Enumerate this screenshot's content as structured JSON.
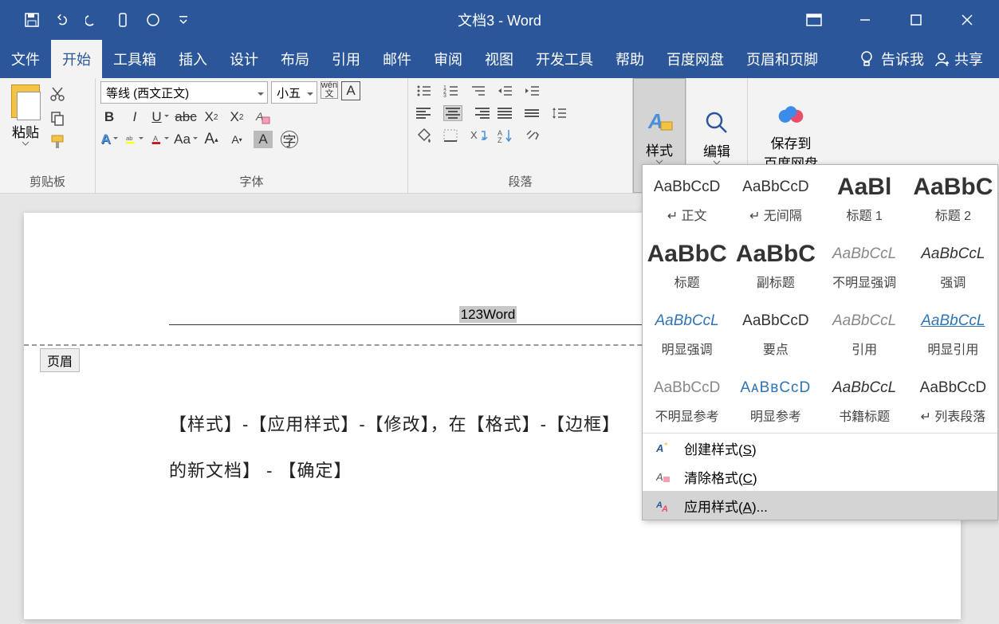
{
  "window": {
    "title": "文档3  -  Word"
  },
  "tabs": {
    "items": [
      "文件",
      "开始",
      "工具箱",
      "插入",
      "设计",
      "布局",
      "引用",
      "邮件",
      "审阅",
      "视图",
      "开发工具",
      "帮助",
      "百度网盘",
      "页眉和页脚"
    ],
    "active": 1,
    "tell_me": "告诉我",
    "share": "共享"
  },
  "ribbon": {
    "clipboard": {
      "paste": "粘贴",
      "label": "剪贴板"
    },
    "font": {
      "name": "等线 (西文正文)",
      "size": "小五",
      "label": "字体"
    },
    "paragraph": {
      "label": "段落"
    },
    "styles_btn": "样式",
    "edit_btn": "编辑",
    "baidu": {
      "line1": "保存到",
      "line2": "百度网盘"
    }
  },
  "styles_gallery": {
    "items": [
      {
        "preview": "AaBbCcD",
        "name": "↵ 正文",
        "cls": ""
      },
      {
        "preview": "AaBbCcD",
        "name": "↵ 无间隔",
        "cls": ""
      },
      {
        "preview": "AaBl",
        "name": "标题 1",
        "cls": "big"
      },
      {
        "preview": "AaBbC",
        "name": "标题 2",
        "cls": "big"
      },
      {
        "preview": "AaBbC",
        "name": "标题",
        "cls": "big"
      },
      {
        "preview": "AaBbC",
        "name": "副标题",
        "cls": "big"
      },
      {
        "preview": "AaBbCcL",
        "name": "不明显强调",
        "cls": "italic gray"
      },
      {
        "preview": "AaBbCcL",
        "name": "强调",
        "cls": "italic"
      },
      {
        "preview": "AaBbCcL",
        "name": "明显强调",
        "cls": "italic blue"
      },
      {
        "preview": "AaBbCcD",
        "name": "要点",
        "cls": ""
      },
      {
        "preview": "AaBbCcL",
        "name": "引用",
        "cls": "italic gray"
      },
      {
        "preview": "AaBbCcL",
        "name": "明显引用",
        "cls": "italic blue ul"
      },
      {
        "preview": "AaBbCcD",
        "name": "不明显参考",
        "cls": "gray"
      },
      {
        "preview": "AᴀBʙCᴄD",
        "name": "明显参考",
        "cls": "blue sc"
      },
      {
        "preview": "AaBbCcL",
        "name": "书籍标题",
        "cls": "italic"
      },
      {
        "preview": "AaBbCcD",
        "name": "↵ 列表段落",
        "cls": ""
      }
    ],
    "menu": {
      "create": {
        "text": "创建样式(",
        "key": "S",
        "tail": ")"
      },
      "clear": {
        "text": "清除格式(",
        "key": "C",
        "tail": ")"
      },
      "apply": {
        "text": "应用样式(",
        "key": "A",
        "tail": ")..."
      }
    }
  },
  "document": {
    "header_label": "页眉",
    "header_text": "123Word",
    "body_line1": "【样式】-【应用样式】-【修改】，在【格式】-【边框】",
    "body_line2": "的新文档】 - 【确定】"
  }
}
